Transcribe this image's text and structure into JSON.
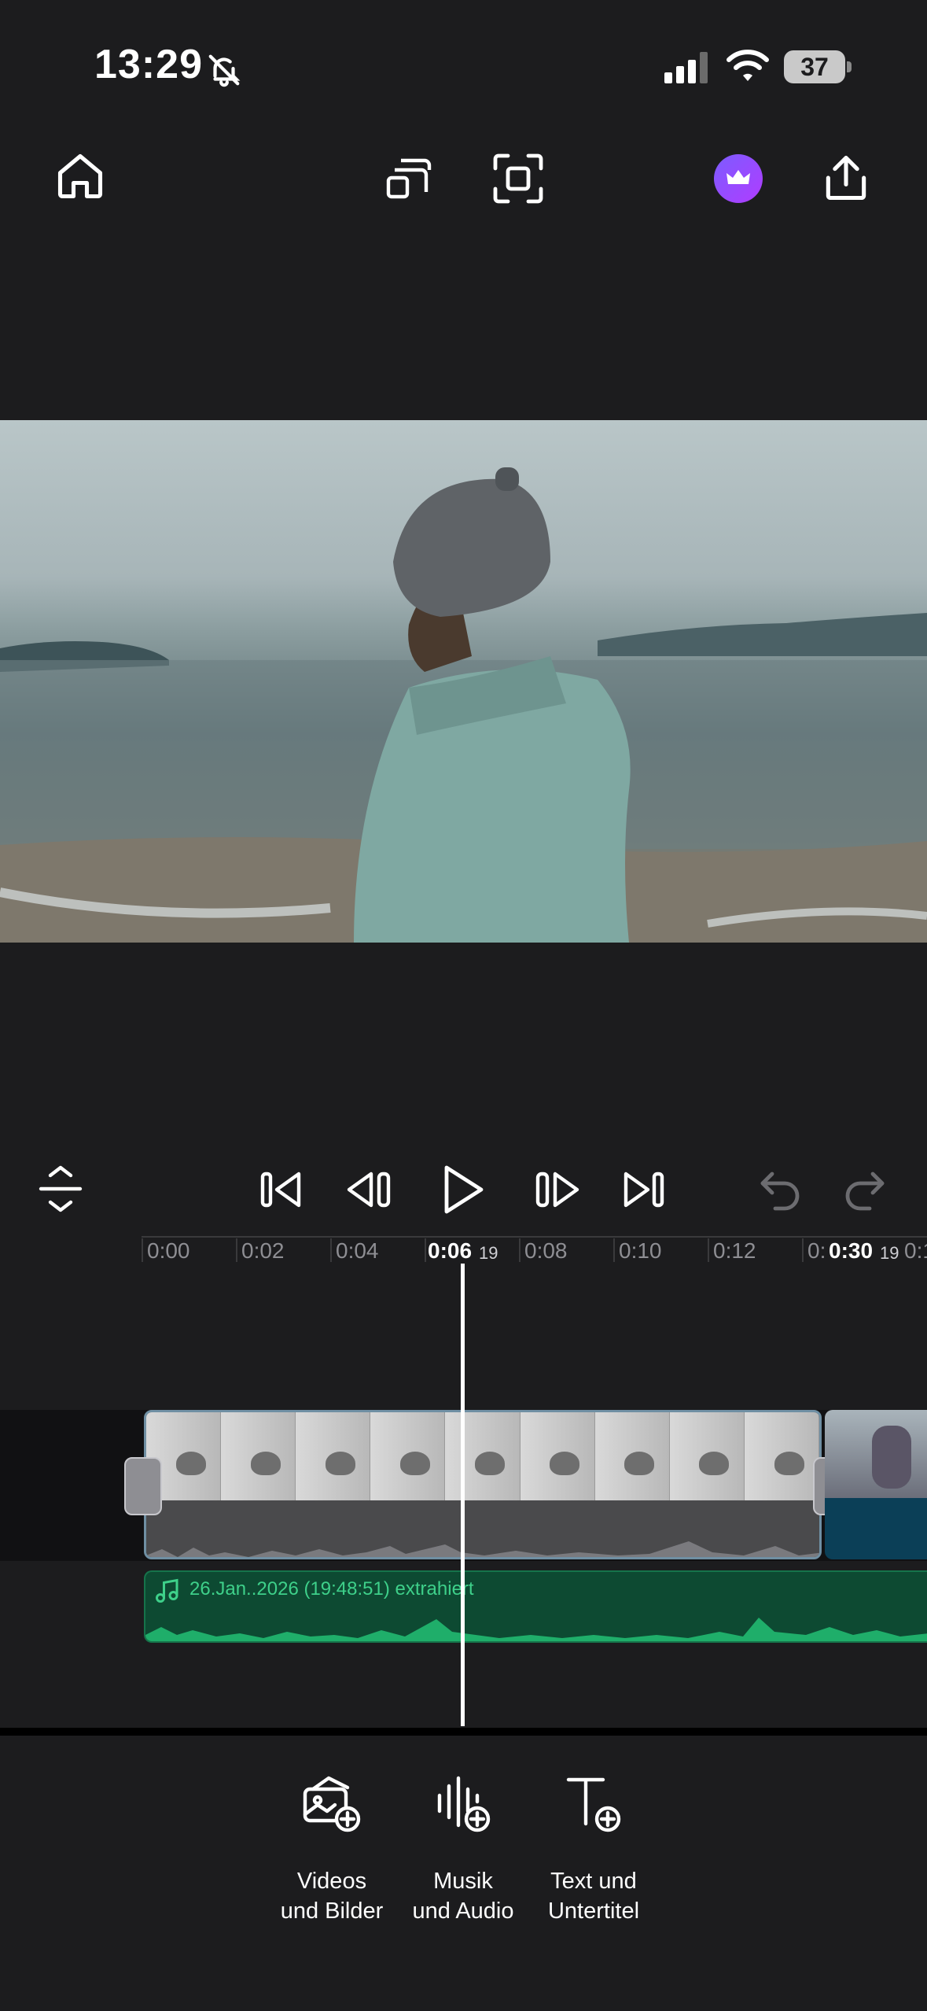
{
  "status_bar": {
    "time": "13:29",
    "battery": "37",
    "icons": [
      "bell-slash-icon",
      "cellular-signal-icon",
      "wifi-icon",
      "battery-icon"
    ]
  },
  "header": {
    "icons": [
      "home-icon",
      "cast-icon",
      "fullscreen-icon",
      "premium-crown-icon",
      "share-icon"
    ]
  },
  "playback": {
    "icons": [
      "collapse-icon",
      "skip-to-start-icon",
      "previous-frame-icon",
      "play-icon",
      "next-frame-icon",
      "skip-to-end-icon",
      "undo-icon",
      "redo-icon"
    ]
  },
  "ruler": {
    "ticks": [
      "0:00",
      "0:02",
      "0:04",
      "0:08",
      "0:10",
      "0:12",
      "0:"
    ],
    "current_time": "0:06",
    "current_frame": "19",
    "total_time": "0:30",
    "total_frame": "19",
    "trailing_tick": "0:1"
  },
  "music_track": {
    "label": "26.Jan..2026 (19:48:51) extrahiert"
  },
  "toolbar": {
    "videos_line1": "Videos",
    "videos_line2": "und Bilder",
    "music_line1": "Musik",
    "music_line2": "und Audio",
    "text_line1": "Text und",
    "text_line2": "Untertitel"
  },
  "colors": {
    "background": "#1c1c1e",
    "accent_purple": "#8e4cff",
    "music_green": "#0d4a32",
    "music_text": "#3ed08a",
    "clip_border": "#6f8fa3"
  }
}
